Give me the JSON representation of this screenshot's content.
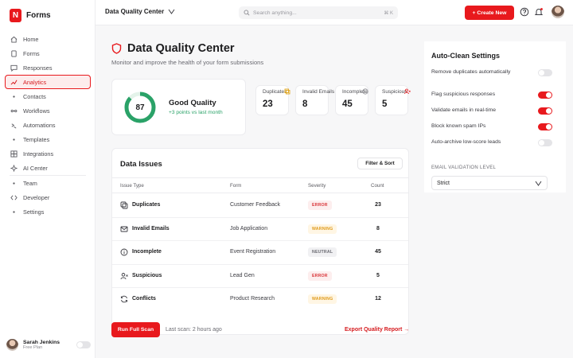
{
  "app": {
    "logo_letter": "N",
    "name": "Forms"
  },
  "sidebar": {
    "items": [
      {
        "label": "Home",
        "icon": "home-icon"
      },
      {
        "label": "Forms",
        "icon": "document-icon"
      },
      {
        "label": "Responses",
        "icon": "chat-icon"
      },
      {
        "label": "Analytics",
        "icon": "chart-icon",
        "active": true
      },
      {
        "label": "Contacts",
        "icon": "dot-icon"
      },
      {
        "label": "Workflows",
        "icon": "workflow-icon"
      },
      {
        "label": "Automations",
        "icon": "automation-icon"
      },
      {
        "label": "Templates",
        "icon": "template-icon"
      },
      {
        "label": "Integrations",
        "icon": "grid-icon"
      },
      {
        "label": "AI Center",
        "icon": "sparkle-icon"
      },
      {
        "label": "Team",
        "icon": "dot-icon"
      },
      {
        "label": "Developer",
        "icon": "code-icon"
      },
      {
        "label": "Settings",
        "icon": "dot-icon"
      }
    ]
  },
  "user": {
    "name": "Sarah Jenkins",
    "plan": "Free Plan"
  },
  "topbar": {
    "workspace": "Data Quality Center",
    "search_placeholder": "Search anything...",
    "search_shortcut": "⌘ K",
    "create_label": "+ Create New"
  },
  "page": {
    "title": "Data Quality Center",
    "subtitle": "Monitor and improve the health of your form submissions"
  },
  "quality": {
    "score": "87",
    "score_fraction": 0.87,
    "label": "Good Quality",
    "trend": "+3 points vs last month"
  },
  "stats": [
    {
      "label": "Duplicates",
      "value": "23",
      "icon": "copy-icon"
    },
    {
      "label": "Invalid Emails",
      "value": "8",
      "icon": "mail-icon"
    },
    {
      "label": "Incomplete",
      "value": "45",
      "icon": "info-icon"
    },
    {
      "label": "Suspicious",
      "value": "5",
      "icon": "user-alert-icon"
    }
  ],
  "issues": {
    "title": "Data Issues",
    "filter_label": "Filter & Sort",
    "columns": {
      "type": "Issue Type",
      "form": "Form",
      "severity": "Severity",
      "count": "Count"
    },
    "rows": [
      {
        "type": "Duplicates",
        "form": "Customer Feedback",
        "severity": "ERROR",
        "level": "error",
        "count": "23",
        "icon": "copy-icon"
      },
      {
        "type": "Invalid Emails",
        "form": "Job Application",
        "severity": "WARNING",
        "level": "warning",
        "count": "8",
        "icon": "mail-icon"
      },
      {
        "type": "Incomplete",
        "form": "Event Registration",
        "severity": "NEUTRAL",
        "level": "neutral",
        "count": "45",
        "icon": "info-icon"
      },
      {
        "type": "Suspicious",
        "form": "Lead Gen",
        "severity": "ERROR",
        "level": "error",
        "count": "5",
        "icon": "user-alert-icon"
      },
      {
        "type": "Conflicts",
        "form": "Product Research",
        "severity": "WARNING",
        "level": "warning",
        "count": "12",
        "icon": "refresh-icon"
      }
    ]
  },
  "actions": {
    "scan_label": "Run Full Scan",
    "last_scan": "Last scan: 2 hours ago",
    "export_label": "Export Quality Report →"
  },
  "autoclean": {
    "title": "Auto-Clean Settings",
    "settings": [
      {
        "label": "Remove duplicates automatically",
        "on": false
      },
      {
        "label": "Flag suspicious responses",
        "on": true
      },
      {
        "label": "Validate emails in real-time",
        "on": true
      },
      {
        "label": "Block known spam IPs",
        "on": true
      },
      {
        "label": "Auto-archive low-score leads",
        "on": false
      }
    ],
    "validation_label": "EMAIL VALIDATION LEVEL",
    "validation_value": "Strict"
  },
  "colors": {
    "accent": "#e8191d",
    "success": "#2aa268"
  }
}
